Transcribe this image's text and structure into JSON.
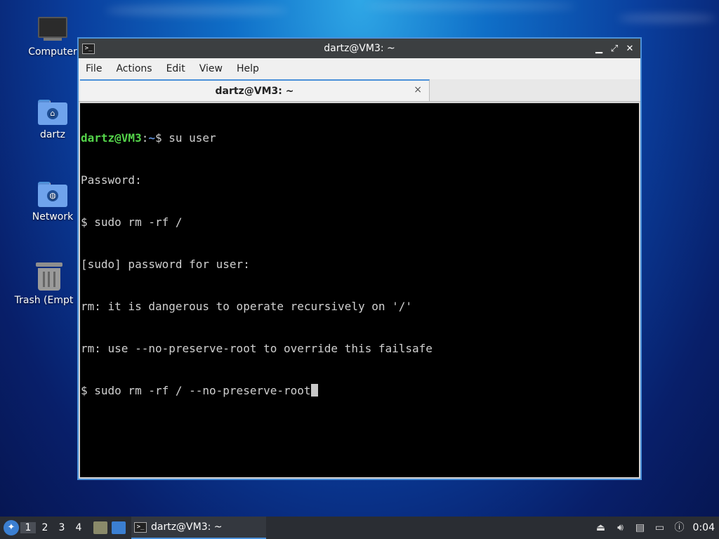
{
  "desktop": {
    "icons": [
      {
        "label": "Computer",
        "icon": "computer-icon"
      },
      {
        "label": "dartz",
        "icon": "home-folder-icon"
      },
      {
        "label": "Network",
        "icon": "network-folder-icon"
      },
      {
        "label": "Trash (Empt",
        "icon": "trash-icon"
      }
    ]
  },
  "window": {
    "title": "dartz@VM3: ~",
    "controls": {
      "minimize": "▁",
      "maximize": "⤢",
      "close": "✕"
    },
    "menu": [
      "File",
      "Actions",
      "Edit",
      "View",
      "Help"
    ],
    "tab": {
      "label": "dartz@VM3: ~",
      "close": "×"
    }
  },
  "terminal": {
    "prompt_user": "dartz@VM3",
    "prompt_colon": ":",
    "prompt_path": "~",
    "prompt_symbol": "$ ",
    "first_command": "su user",
    "lines": [
      "Password:",
      "$ sudo rm -rf /",
      "[sudo] password for user:",
      "rm: it is dangerous to operate recursively on '/'",
      "rm: use --no-preserve-root to override this failsafe"
    ],
    "current_input": "$ sudo rm -rf / --no-preserve-root"
  },
  "taskbar": {
    "workspaces": [
      "1",
      "2",
      "3",
      "4"
    ],
    "active_workspace": "1",
    "task_label": "dartz@VM3: ~",
    "clock": "0:04"
  },
  "colors": {
    "prompt_user": "#54d34a",
    "prompt_path": "#5f8fd8",
    "accent": "#4a90d9"
  }
}
